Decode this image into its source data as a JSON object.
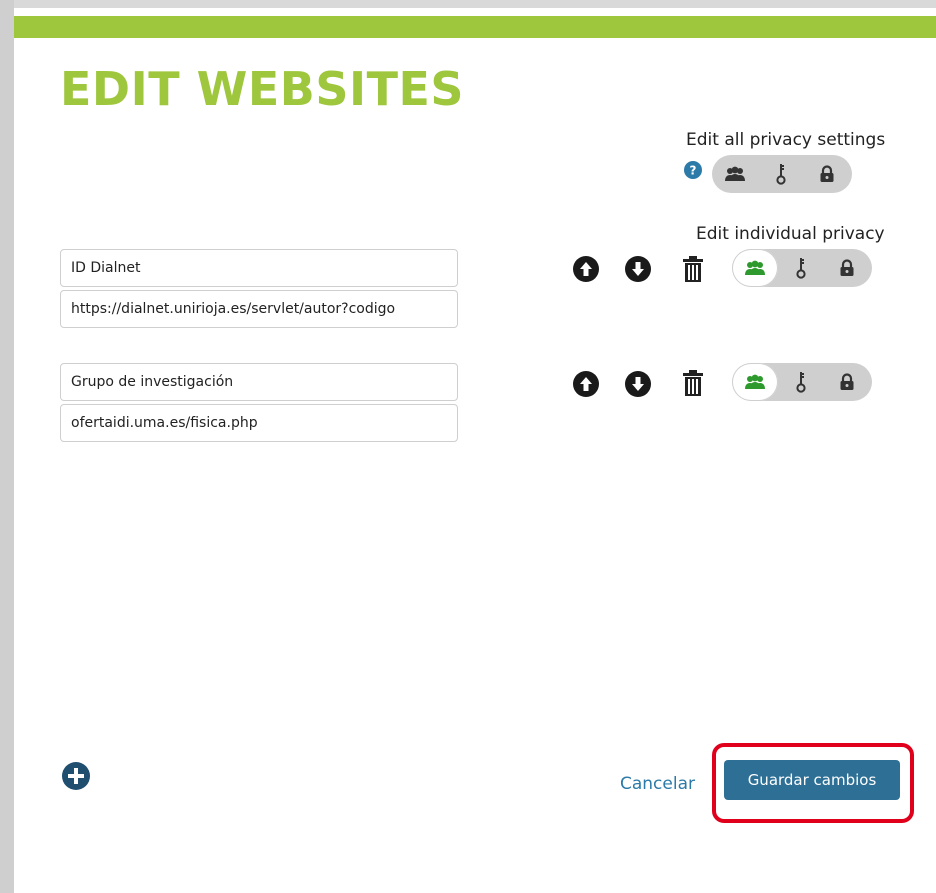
{
  "dialog": {
    "title": "EDIT WEBSITES",
    "accent_color": "#9ec73d"
  },
  "privacy": {
    "all_label": "Edit all privacy settings",
    "individual_label": "Edit individual privacy",
    "help_icon": "question-circle-icon",
    "options": [
      "group-icon",
      "key-icon",
      "lock-icon"
    ],
    "active_color": "#2e9a2e"
  },
  "websites": [
    {
      "name": "ID Dialnet",
      "url": "https://dialnet.unirioja.es/servlet/autor?codigo",
      "privacy": "group"
    },
    {
      "name": "Grupo de investigación",
      "url": "ofertaidi.uma.es/fisica.php",
      "privacy": "group"
    }
  ],
  "actions": {
    "cancel_label": "Cancelar",
    "save_label": "Guardar cambios",
    "add_icon": "plus-circle-icon",
    "save_color": "#2d6f95",
    "highlight_color": "#e0001b"
  }
}
